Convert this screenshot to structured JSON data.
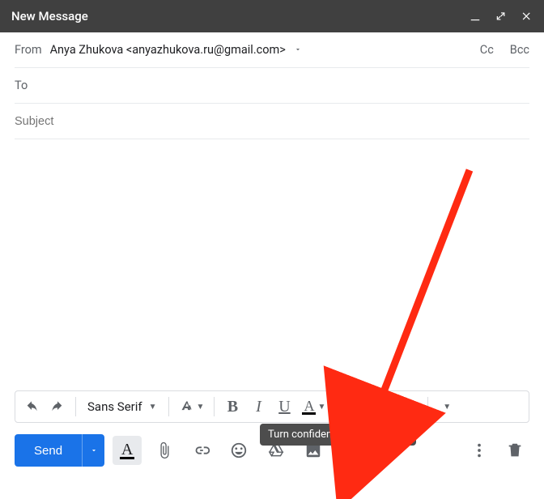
{
  "titlebar": {
    "title": "New Message"
  },
  "fields": {
    "from_label": "From",
    "from_value": "Anya Zhukova <anyazhukova.ru@gmail.com>",
    "to_label": "To",
    "to_value": "",
    "cc": "Cc",
    "bcc": "Bcc",
    "subject_placeholder": "Subject",
    "subject_value": ""
  },
  "body": {
    "value": ""
  },
  "format": {
    "font": "Sans Serif",
    "bold": "B",
    "italic": "I",
    "underline": "U",
    "text_format_letter": "A"
  },
  "actions": {
    "send": "Send"
  },
  "tooltip": {
    "confidential": "Turn confidential mode on/off"
  }
}
